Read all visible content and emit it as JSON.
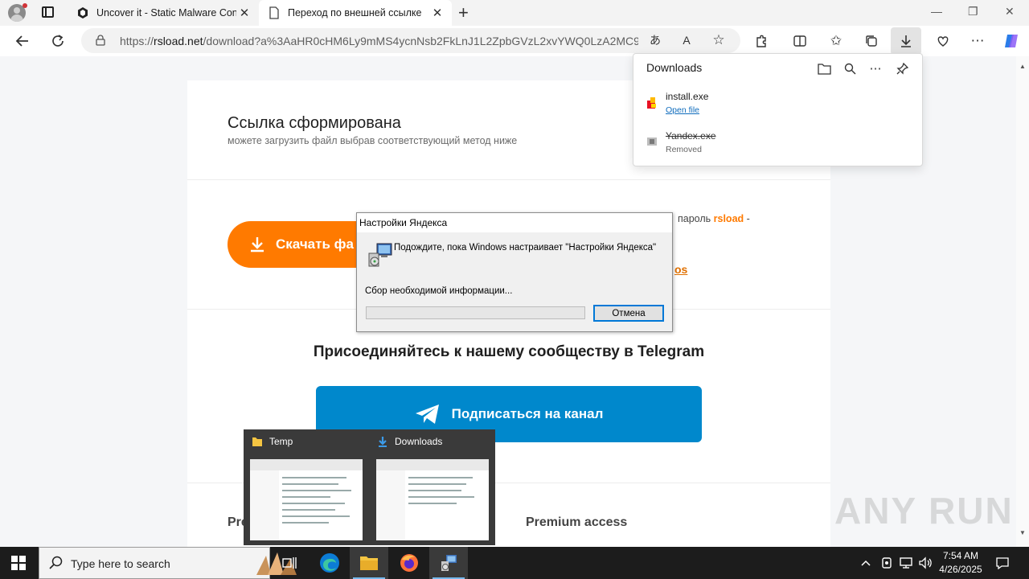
{
  "browser": {
    "tabs": [
      {
        "title": "Uncover it - Static Malware Confi",
        "active": false
      },
      {
        "title": "Переход по внешней ссылке",
        "active": true
      }
    ],
    "url_prefix": "https://",
    "url_domain": "rsload.net",
    "url_rest": "/download?a%3AaHR0cHM6Ly9mMS4ycnNsb2FkLnJ1L2ZpbGVzL2xvYWQ0LzA2MC9..."
  },
  "page": {
    "title": "Ссылка сформирована",
    "subtitle": "можете загрузить файл выбрав соответствующий метод ниже",
    "download_button": "Скачать фа",
    "password_text": "пароль ",
    "password_value": "rsload",
    "password_suffix": " -",
    "os_link": "os",
    "telegram_heading": "Присоединяйтесь к нашему сообществу в Telegram",
    "telegram_button": "Подписаться на канал",
    "premium_left": "Pre",
    "premium_right": "Premium access"
  },
  "downloads": {
    "title": "Downloads",
    "items": [
      {
        "name": "install.exe",
        "action": "Open file"
      },
      {
        "name": "Yandex.exe",
        "status": "Removed"
      }
    ]
  },
  "dialog": {
    "title": "Настройки Яндекса",
    "message": "Подождите, пока Windows настраивает \"Настройки Яндекса\"",
    "status": "Сбор необходимой информации...",
    "cancel": "Отмена",
    "progress": 0
  },
  "preview": {
    "windows": [
      {
        "label": "Temp"
      },
      {
        "label": "Downloads"
      }
    ]
  },
  "watermark": "ANY RUN",
  "taskbar": {
    "search_placeholder": "Type here to search",
    "time": "7:54 AM",
    "date": "4/26/2025"
  },
  "colors": {
    "orange": "#ff7a00",
    "telegram": "#0088cc",
    "link": "#0f6cbd"
  }
}
